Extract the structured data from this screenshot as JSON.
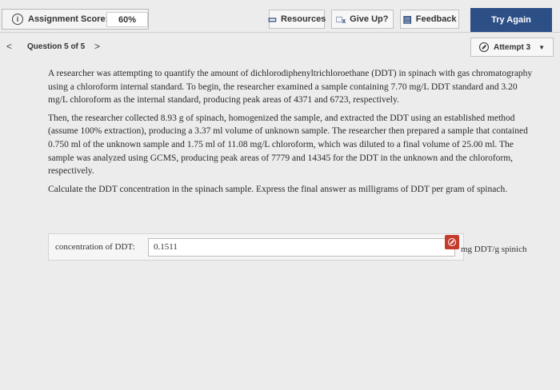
{
  "topbar": {
    "score_label": "Assignment Score:",
    "score_value": "60%",
    "resources_label": "Resources",
    "give_up_label": "Give Up?",
    "feedback_label": "Feedback",
    "try_again_label": "Try Again"
  },
  "nav": {
    "prev": "<",
    "question_label": "Question 5 of 5",
    "next": ">",
    "attempt_label": "Attempt 3"
  },
  "question": {
    "p1": "A researcher was attempting to quantify the amount of dichlorodiphenyltrichloroethane (DDT) in spinach with gas chromatography using a chloroform internal standard. To begin, the researcher examined a sample containing 7.70 mg/L DDT standard and 3.20 mg/L chloroform as the internal standard, producing peak areas of 4371 and 6723, respectively.",
    "p2": "Then, the researcher collected 8.93 g of spinach, homogenized the sample, and extracted the DDT using an established method (assume 100% extraction), producing a 3.37 ml volume of unknown sample. The researcher then prepared a sample that contained 0.750 ml of the unknown sample and 1.75 ml of 11.08 mg/L chloroform, which was diluted to a final volume of 25.00 ml. The sample was analyzed using GCMS, producing peak areas of 7779 and 14345 for the DDT in the unknown and the chloroform, respectively.",
    "p3": "Calculate the DDT concentration in the spinach sample. Express the final answer as milligrams of DDT per gram of spinach."
  },
  "answer": {
    "label": "concentration of DDT:",
    "value": "0.1511",
    "units": "mg DDT/g spinich"
  },
  "colors": {
    "primary": "#2c4f86",
    "incorrect": "#c43a2c"
  }
}
